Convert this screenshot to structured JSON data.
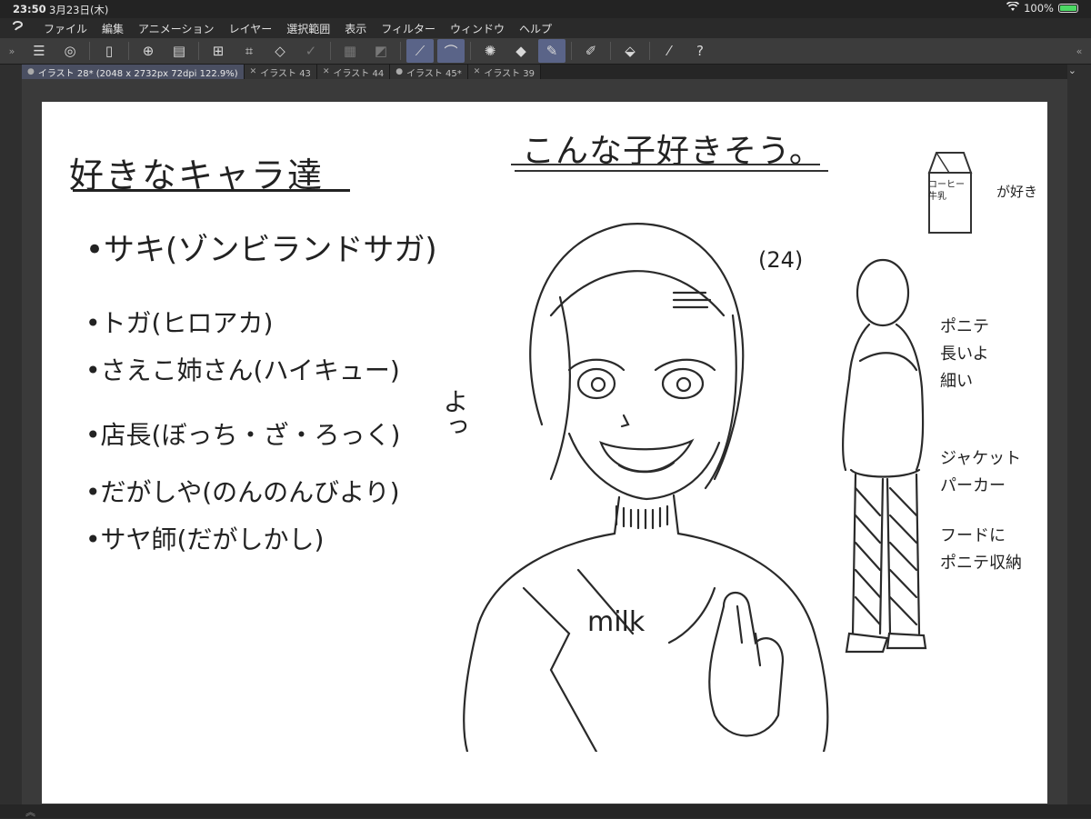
{
  "status": {
    "time": "23:50",
    "date": "3月23日(木)",
    "battery": "100%",
    "battery_level": 1.0
  },
  "menu": {
    "items": [
      "ファイル",
      "編集",
      "アニメーション",
      "レイヤー",
      "選択範囲",
      "表示",
      "フィルター",
      "ウィンドウ",
      "ヘルプ"
    ]
  },
  "tabs": [
    {
      "label": "イラスト 28* (2048 x 2732px 72dpi 122.9%)",
      "active": true
    },
    {
      "label": "イラスト 43",
      "active": false
    },
    {
      "label": "イラスト 44",
      "active": false
    },
    {
      "label": "イラスト 45*",
      "active": false
    },
    {
      "label": "イラスト 39",
      "active": false
    }
  ],
  "toolbar_icons": [
    "menu-icon",
    "clip-studio-icon",
    "device-icon",
    "new-canvas-icon",
    "open-folder-icon",
    "transform-icon",
    "crop-icon",
    "perspective-icon",
    "confirm-icon",
    "select-all-icon",
    "invert-selection-icon",
    "ruler-icon",
    "brush-icon",
    "loading-icon",
    "eraser-icon",
    "pen-icon",
    "pencil-icon",
    "fill-icon",
    "eyedropper-icon",
    "help-icon"
  ],
  "canvas": {
    "list_title": "好きなキャラ達",
    "list": [
      "•サキ(ゾンビランドサガ)",
      "•トガ(ヒロアカ)",
      "•さえこ姉さん(ハイキュー)",
      "•店長(ぼっち・ざ・ろっく)",
      "•だがしや(のんのんびより)",
      "•サヤ師(だがしかし)"
    ],
    "drawing_title": "こんな子好きそう。",
    "age": "(24)",
    "yo": "よっ",
    "milk_label": "コーヒー牛乳",
    "likes": "が好き",
    "shirt_text": "milk",
    "notes": [
      "ポニテ",
      "長いよ",
      "細い",
      "ジャケット",
      "パーカー",
      "フードに",
      "ポニテ収納"
    ]
  }
}
